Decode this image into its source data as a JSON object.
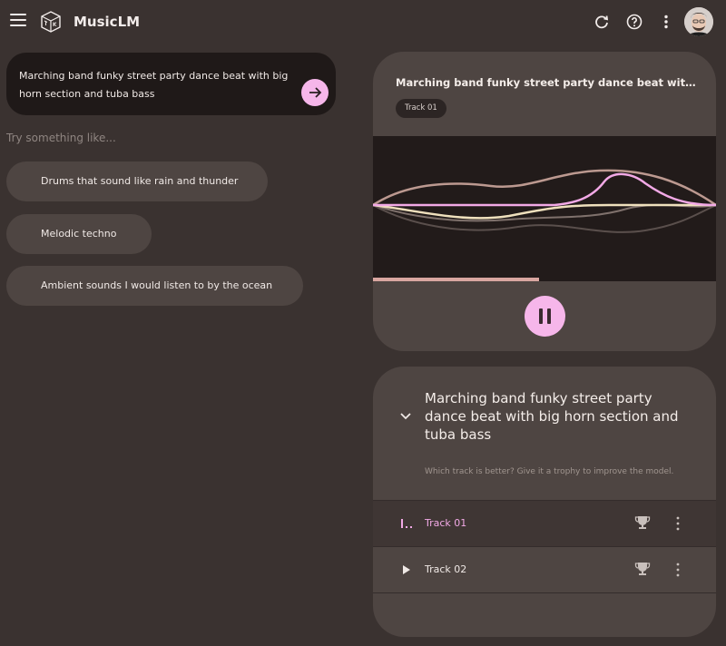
{
  "app": {
    "title": "MusicLM"
  },
  "header_icons": [
    "menu-icon",
    "logo-icon",
    "refresh-icon",
    "help-icon",
    "more-vert-icon",
    "avatar"
  ],
  "prompt": {
    "value": "Marching band funky street party dance beat with big horn section and tuba bass",
    "submit_icon": "arrow-right-icon"
  },
  "suggestions": {
    "label": "Try something like...",
    "items": [
      "Drums that sound like rain and thunder",
      "Melodic techno",
      "Ambient sounds I would listen to by the ocean"
    ]
  },
  "player": {
    "title": "Marching band funky street party dance beat with big horn section and tuba bass",
    "active_track": "Track 01",
    "progress": 0.485,
    "state": "playing",
    "control_icon": "pause-icon"
  },
  "results": {
    "title": "Marching band funky street party dance beat with big horn section and tuba bass",
    "hint": "Which track is better? Give it a trophy to improve the model.",
    "tracks": [
      {
        "label": "Track 01",
        "status_icon": "playing-bars-icon",
        "active": true
      },
      {
        "label": "Track 02",
        "status_icon": "play-icon",
        "active": false
      }
    ]
  },
  "colors": {
    "background": "#3a3230",
    "card": "#4e4542",
    "accent": "#f6b6ea",
    "active_text": "#f2a9e6",
    "visualizer_bg": "#221b1a",
    "progress": "#d9a6a0"
  }
}
